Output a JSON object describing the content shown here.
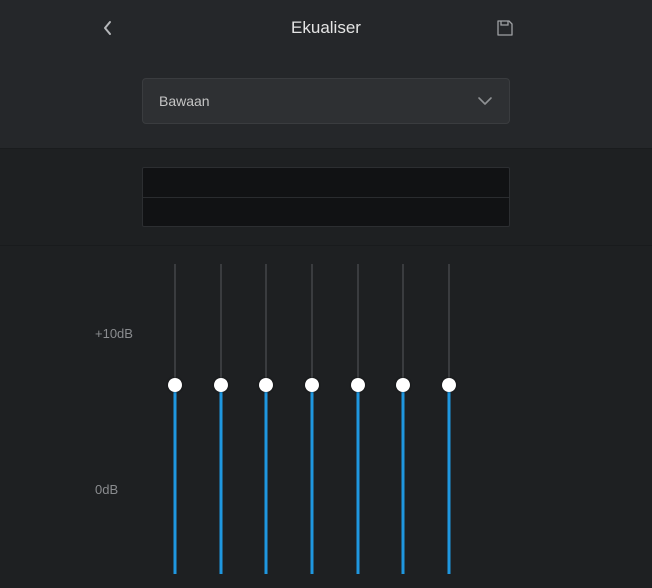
{
  "header": {
    "title": "Ekualiser"
  },
  "preset": {
    "selected": "Bawaan"
  },
  "labels": {
    "plus10": "+10dB",
    "zero": "0dB"
  },
  "sliders": {
    "count": 7,
    "valuePercent": 39
  },
  "colors": {
    "accent": "#1f97e0",
    "bg": "#1e2022"
  }
}
